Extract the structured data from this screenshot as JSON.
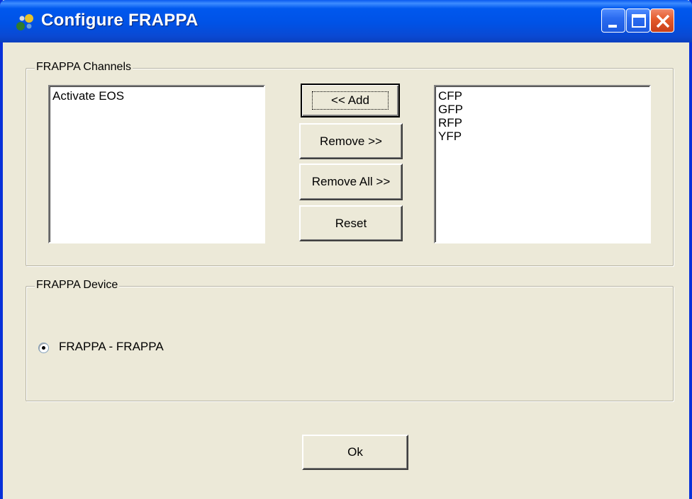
{
  "window": {
    "title": "Configure FRAPPA"
  },
  "channels_group": {
    "label": "FRAPPA Channels",
    "available_list": [
      "Activate EOS"
    ],
    "selected_list": [
      "CFP",
      "GFP",
      "RFP",
      "YFP"
    ],
    "buttons": {
      "add": "<< Add",
      "remove": "Remove >>",
      "remove_all": "Remove All >>",
      "reset": "Reset"
    }
  },
  "device_group": {
    "label": "FRAPPA Device",
    "options": [
      {
        "label": "FRAPPA - FRAPPA",
        "selected": true
      }
    ]
  },
  "footer": {
    "ok_label": "Ok"
  },
  "colors": {
    "titlebar": "#0058ee",
    "window_bg": "#ece9d8",
    "close_button": "#e45a2a"
  }
}
